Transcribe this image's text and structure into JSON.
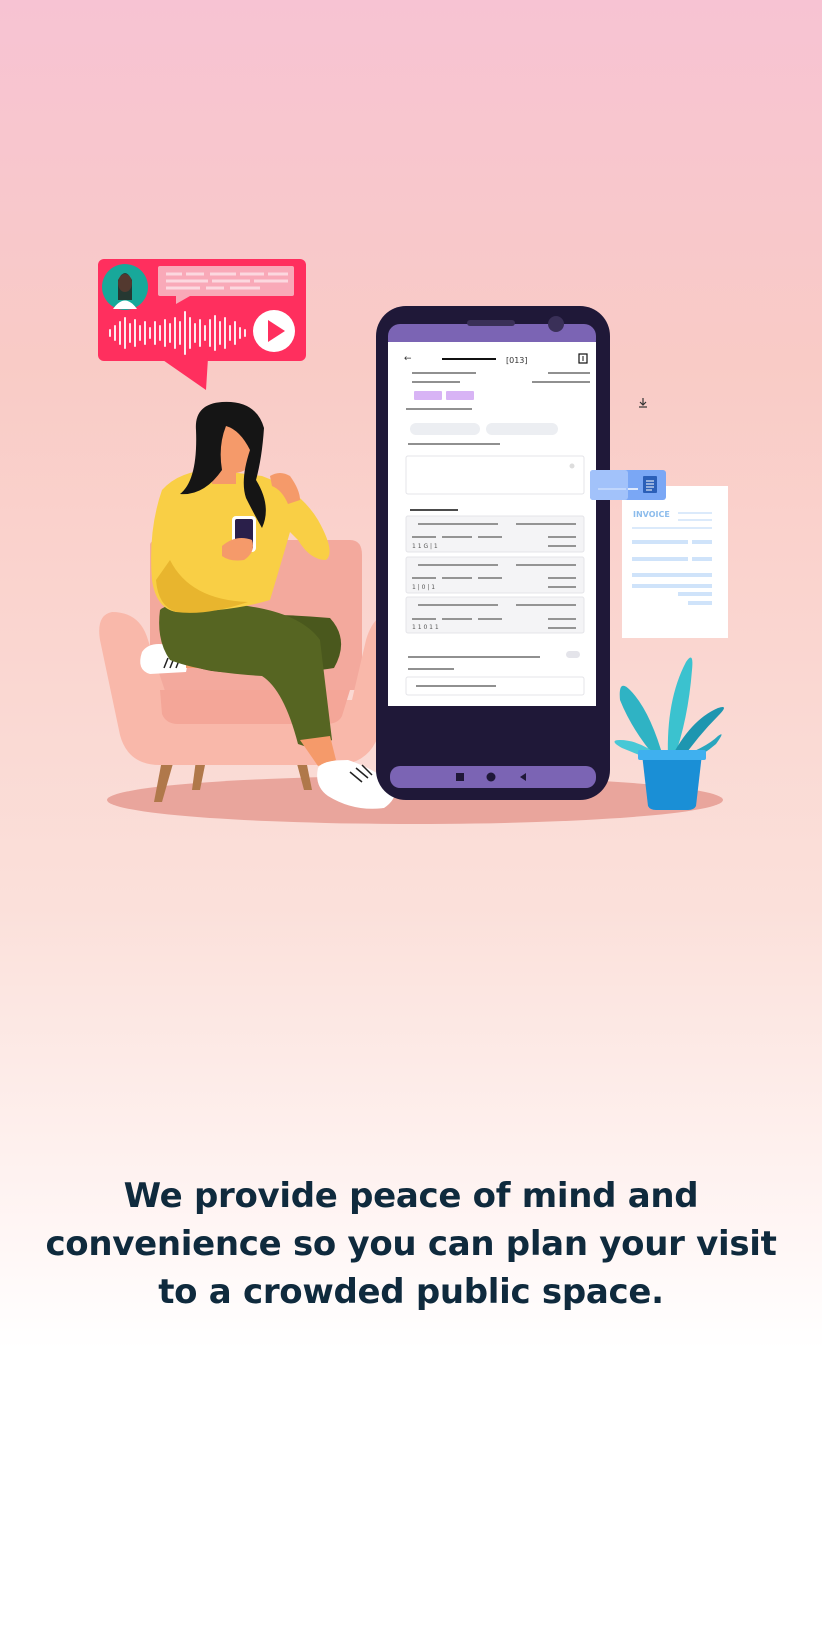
{
  "phone": {
    "header_code": "[013]"
  },
  "invoice": {
    "label": "INVOICE"
  },
  "caption": {
    "text": "We provide peace of mind and convenience so you can plan your visit to a crowded public space."
  },
  "icons": [
    "back-arrow-icon",
    "download-icon",
    "add-document-icon",
    "play-icon",
    "document-icon",
    "square-nav-icon",
    "circle-nav-icon",
    "triangle-back-nav-icon"
  ],
  "colors": {
    "caption_text": "#0f2a3d",
    "voice_bubble": "#ff2f5e",
    "phone_body": "#1f1838",
    "phone_accent": "#7b64b4",
    "card_blue": "#7aa7f5",
    "sweater": "#f9cf45",
    "pants": "#566522",
    "chair": "#f9b8aa"
  }
}
